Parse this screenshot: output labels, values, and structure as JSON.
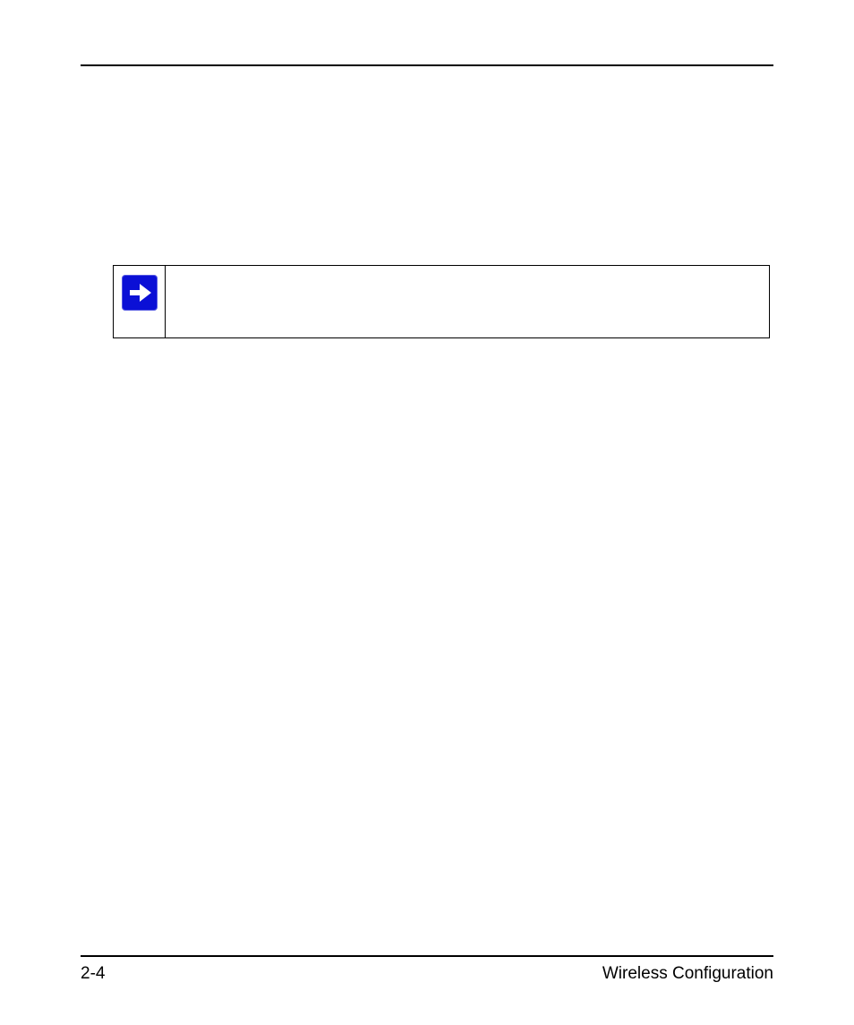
{
  "footer": {
    "page_number": "2-4",
    "section_title": "Wireless Configuration"
  },
  "note": {
    "icon_name": "arrow-right-icon"
  }
}
